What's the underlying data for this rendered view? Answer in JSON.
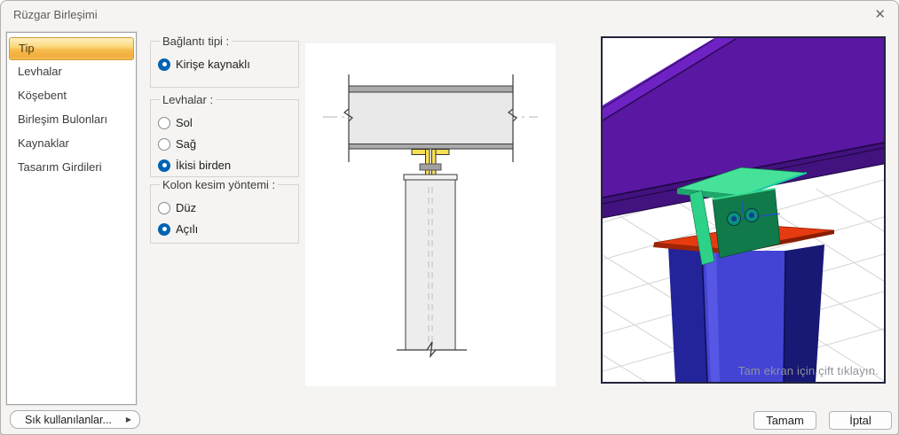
{
  "window": {
    "title": "Rüzgar Birleşimi",
    "close_icon": "✕"
  },
  "sidebar": {
    "items": [
      {
        "label": "Tip",
        "selected": true
      },
      {
        "label": "Levhalar",
        "selected": false
      },
      {
        "label": "Köşebent",
        "selected": false
      },
      {
        "label": "Birleşim Bulonları",
        "selected": false
      },
      {
        "label": "Kaynaklar",
        "selected": false
      },
      {
        "label": "Tasarım Girdileri",
        "selected": false
      }
    ]
  },
  "options": {
    "groups": [
      {
        "title": "Bağlantı tipi :",
        "radios": [
          {
            "label": "Kirişe kaynaklı",
            "checked": true
          }
        ]
      },
      {
        "title": "Levhalar :",
        "radios": [
          {
            "label": "Sol",
            "checked": false
          },
          {
            "label": "Sağ",
            "checked": false
          },
          {
            "label": "İkisi birden",
            "checked": true
          }
        ]
      },
      {
        "title": "Kolon kesim yöntemi :",
        "radios": [
          {
            "label": "Düz",
            "checked": false
          },
          {
            "label": "Açılı",
            "checked": true
          }
        ]
      }
    ]
  },
  "preview3d": {
    "caption": "Tam ekran için çift tıklayın."
  },
  "footer": {
    "favorites_label": "Sık kullanılanlar...",
    "favorites_arrow": "▶",
    "ok_label": "Tamam",
    "cancel_label": "İptal"
  },
  "colors": {
    "selected_item_orange": "#f6bd4e",
    "radio_blue": "#0063b1",
    "beam_purple": "#5a17a2",
    "column_blue": "#4444d4",
    "cap_plate_red": "#e63a10",
    "bracket_green": "#2ed188",
    "connection_yellow": "#f6df55"
  }
}
